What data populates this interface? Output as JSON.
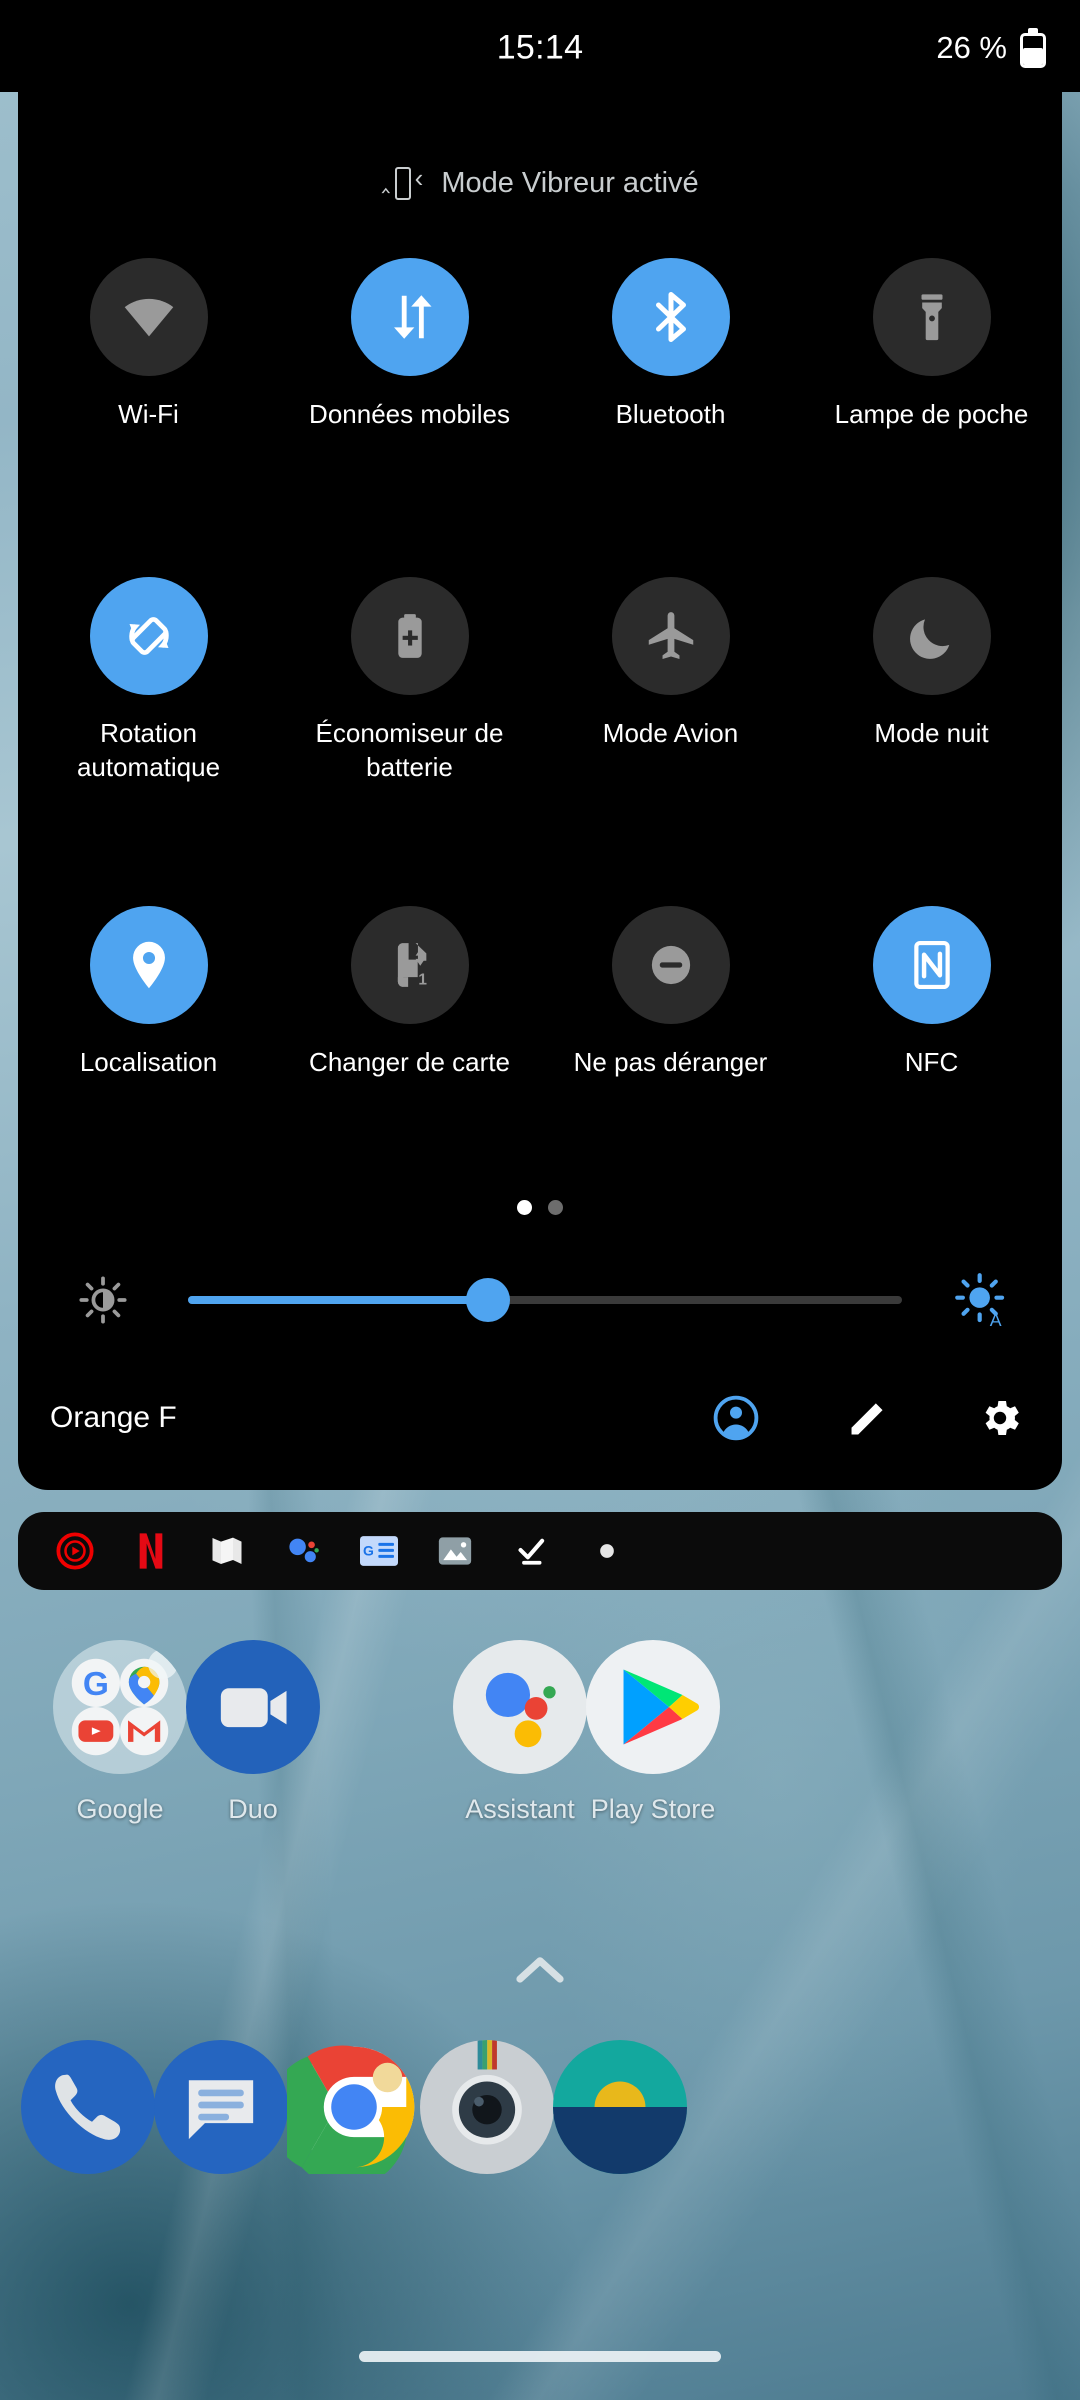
{
  "status_bar": {
    "clock": "15:14",
    "battery_text": "26 %",
    "battery_icon": "battery-icon"
  },
  "quick_settings": {
    "vibrate_notice": {
      "icon": "vibration-icon",
      "text": "Mode Vibreur activé"
    },
    "tiles": [
      {
        "label": "Wi-Fi",
        "icon": "wifi-icon",
        "state": "off"
      },
      {
        "label": "Données mobiles",
        "icon": "mobile-data-icon",
        "state": "on"
      },
      {
        "label": "Bluetooth",
        "icon": "bluetooth-icon",
        "state": "on"
      },
      {
        "label": "Lampe de poche",
        "icon": "flashlight-icon",
        "state": "off"
      },
      {
        "label": "Rotation automatique",
        "icon": "auto-rotate-icon",
        "state": "on"
      },
      {
        "label": "Économiseur de batterie",
        "icon": "battery-saver-icon",
        "state": "off"
      },
      {
        "label": "Mode Avion",
        "icon": "airplane-icon",
        "state": "off"
      },
      {
        "label": "Mode nuit",
        "icon": "night-mode-icon",
        "state": "off"
      },
      {
        "label": "Localisation",
        "icon": "location-pin-icon",
        "state": "on"
      },
      {
        "label": "Changer de carte",
        "icon": "sim-swap-icon",
        "state": "off"
      },
      {
        "label": "Ne pas déranger",
        "icon": "do-not-disturb-icon",
        "state": "off"
      },
      {
        "label": "NFC",
        "icon": "nfc-icon",
        "state": "on"
      }
    ],
    "pages": {
      "count": 2,
      "current": 1
    },
    "brightness": {
      "value_percent": 42,
      "low_icon": "brightness-low-icon",
      "auto_icon": "brightness-auto-icon"
    },
    "footer": {
      "carrier": "Orange F",
      "actions": [
        {
          "name": "user-account-icon",
          "label": "Compte utilisateur"
        },
        {
          "name": "edit-pencil-icon",
          "label": "Modifier"
        },
        {
          "name": "settings-gear-icon",
          "label": "Paramètres"
        }
      ]
    },
    "accent_color": "#4fa4f0",
    "tile_off_color": "#2b2b2b",
    "panel_background": "#000000"
  },
  "notification_strip": {
    "icons": [
      {
        "name": "youtube-music-icon"
      },
      {
        "name": "netflix-icon"
      },
      {
        "name": "google-maps-icon"
      },
      {
        "name": "google-assistant-icon"
      },
      {
        "name": "google-news-icon"
      },
      {
        "name": "photos-gallery-icon"
      },
      {
        "name": "download-complete-icon"
      },
      {
        "name": "more-notifications-dot-icon"
      }
    ]
  },
  "home_screen": {
    "apps": [
      {
        "label": "Google",
        "icon": "google-folder-icon"
      },
      {
        "label": "Duo",
        "icon": "google-duo-icon"
      },
      {
        "label": "Assistant",
        "icon": "google-assistant-icon"
      },
      {
        "label": "Play Store",
        "icon": "google-play-store-icon"
      }
    ],
    "app_drawer_handle": "chevron-up-icon",
    "dock": [
      {
        "label": "Téléphone",
        "icon": "phone-dialer-icon"
      },
      {
        "label": "Messages",
        "icon": "messages-icon"
      },
      {
        "label": "Chrome",
        "icon": "chrome-icon"
      },
      {
        "label": "Appareil photo",
        "icon": "camera-icon"
      },
      {
        "label": "Météo",
        "icon": "sunrise-app-icon"
      }
    ],
    "gesture_pill": "navigation-home-pill"
  }
}
